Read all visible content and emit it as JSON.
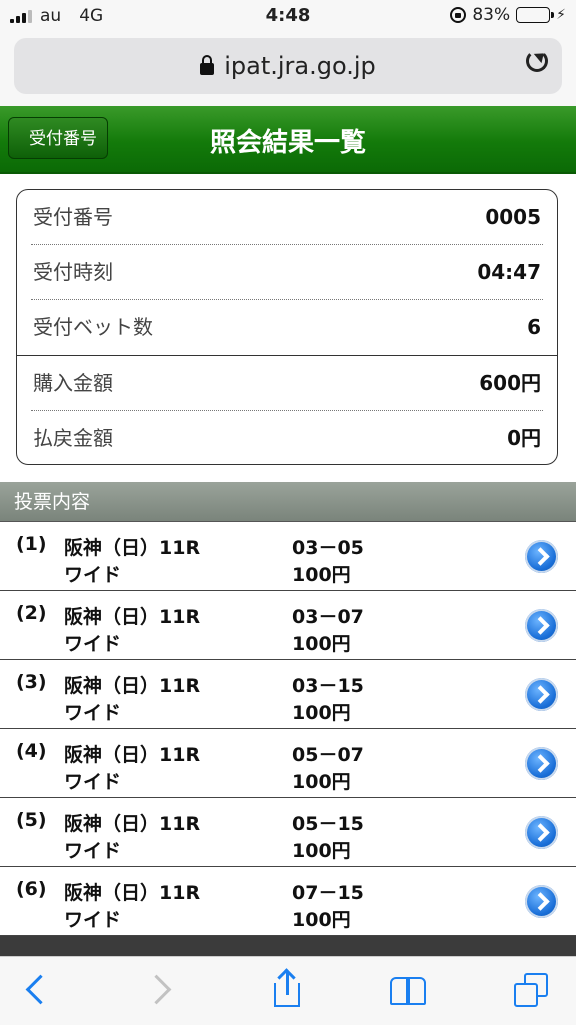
{
  "status_bar": {
    "carrier": "au",
    "network": "4G",
    "time": "4:48",
    "battery": "83%"
  },
  "browser": {
    "url": "ipat.jra.go.jp"
  },
  "header": {
    "back_label": "受付番号",
    "title": "照会結果一覧"
  },
  "summary": {
    "rows": [
      {
        "label": "受付番号",
        "value": "0005"
      },
      {
        "label": "受付時刻",
        "value": "04:47"
      },
      {
        "label": "受付ベット数",
        "value": "6"
      },
      {
        "label": "購入金額",
        "value": "600円"
      },
      {
        "label": "払戻金額",
        "value": "0円"
      }
    ]
  },
  "section_title": "投票内容",
  "votes": [
    {
      "num": "(1)",
      "race": "阪神（日）11R",
      "kind": "ワイド",
      "combo": "03－05",
      "amount": "100円"
    },
    {
      "num": "(2)",
      "race": "阪神（日）11R",
      "kind": "ワイド",
      "combo": "03－07",
      "amount": "100円"
    },
    {
      "num": "(3)",
      "race": "阪神（日）11R",
      "kind": "ワイド",
      "combo": "03－15",
      "amount": "100円"
    },
    {
      "num": "(4)",
      "race": "阪神（日）11R",
      "kind": "ワイド",
      "combo": "05－07",
      "amount": "100円"
    },
    {
      "num": "(5)",
      "race": "阪神（日）11R",
      "kind": "ワイド",
      "combo": "05－15",
      "amount": "100円"
    },
    {
      "num": "(6)",
      "race": "阪神（日）11R",
      "kind": "ワイド",
      "combo": "07－15",
      "amount": "100円"
    }
  ],
  "colors": {
    "header_green": "#137a0a",
    "section_gray": "#8a938b",
    "link_blue": "#1a7ff0"
  },
  "icons": {
    "back": "back-arrow-icon",
    "forward": "forward-arrow-icon",
    "share": "share-icon",
    "bookmarks": "bookmarks-icon",
    "tabs": "tabs-icon",
    "row": "chevron-right-circle-icon"
  }
}
